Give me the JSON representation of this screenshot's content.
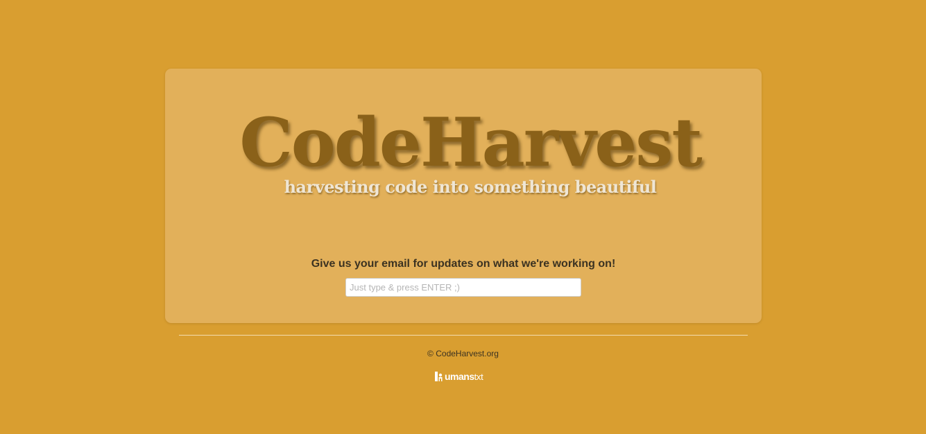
{
  "brand": {
    "logo_text": "CodeHarvest",
    "tagline": "harvesting code into something beautiful"
  },
  "signup": {
    "label": "Give us your email for updates on what we're working on!",
    "placeholder": "Just type & press ENTER ;)",
    "value": ""
  },
  "footer": {
    "copyright": "© CodeHarvest.org",
    "humans_badge": {
      "icon": "humans-person-icon",
      "text": "umans",
      "ext": "txt"
    }
  },
  "colors": {
    "page_background": "#d99e30",
    "card_background": "#e2b05a",
    "logo": "#8a6119",
    "tagline": "#efe6d5"
  }
}
